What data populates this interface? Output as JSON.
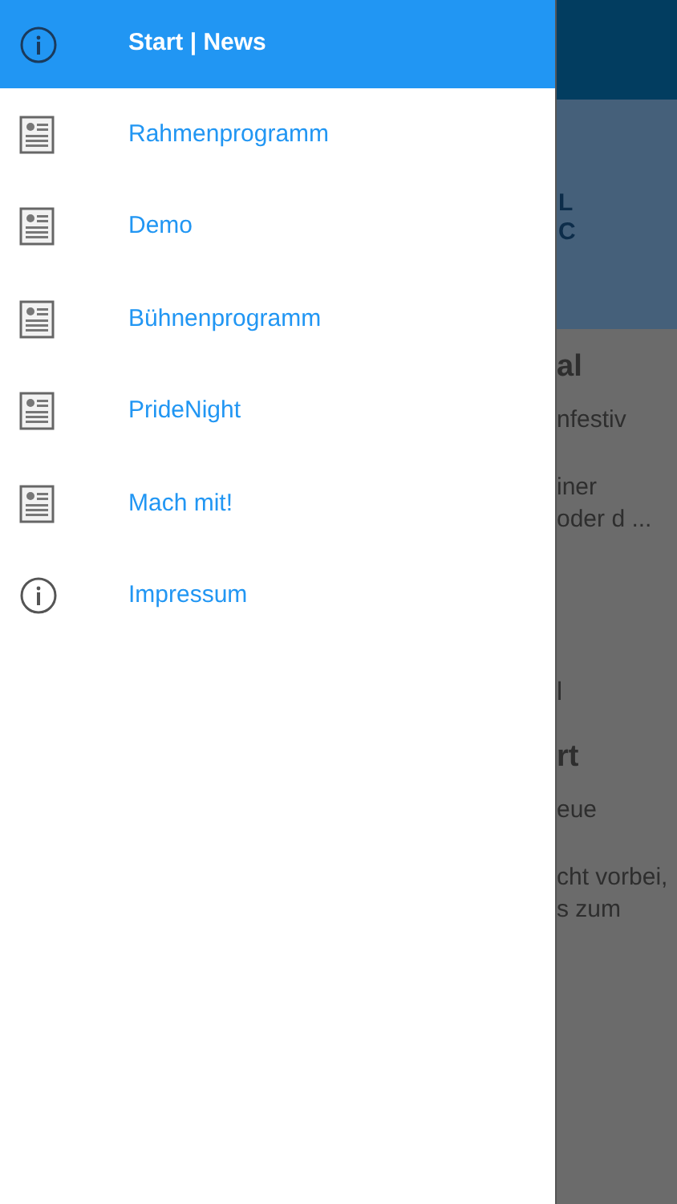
{
  "drawer": {
    "items": [
      {
        "label": "Start | News",
        "kind": "info",
        "selected": true
      },
      {
        "label": "Rahmenprogramm",
        "kind": "news",
        "selected": false
      },
      {
        "label": "Demo",
        "kind": "news",
        "selected": false
      },
      {
        "label": "Bühnenprogramm",
        "kind": "news",
        "selected": false
      },
      {
        "label": "PrideNight",
        "kind": "news",
        "selected": false
      },
      {
        "label": "Mach mit!",
        "kind": "news",
        "selected": false
      },
      {
        "label": "Impressum",
        "kind": "info",
        "selected": false
      }
    ]
  },
  "background": {
    "logo_fragments": [
      "L",
      "C"
    ],
    "posts": [
      {
        "title": "al",
        "lines": [
          "nfestiv",
          "iner",
          "oder d ..."
        ]
      },
      {
        "pre": "l",
        "title": "rt",
        "lines": [
          "eue",
          "cht vorbei,",
          "s zum"
        ]
      }
    ]
  }
}
